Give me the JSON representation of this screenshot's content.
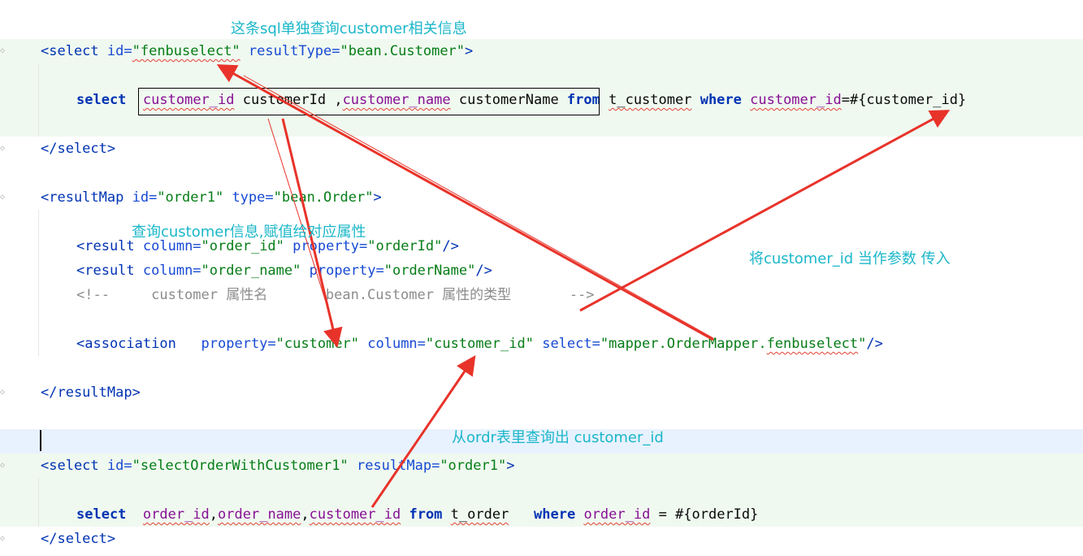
{
  "code": {
    "l1": {
      "open": "<select ",
      "id_attr": "id=",
      "id_val": "\"fenbuselect\"",
      "rt_attr": " resultType=",
      "rt_val": "\"bean.Customer\"",
      "close": ">"
    },
    "l2": {
      "kw": "select ",
      "c1": "customer_id",
      "a1": " customerId ,",
      "c2": "customer_name",
      "a2": " customerName ",
      "kw2": "from ",
      "tbl": "t_customer",
      "kw3": " where ",
      "c3": "customer_id",
      "rest": "=#{customer_id}"
    },
    "l3": {
      "text": "</select>"
    },
    "l4": {
      "open": "<resultMap ",
      "id_attr": "id=",
      "id_val": "\"order1\"",
      "t_attr": " type=",
      "t_val": "\"bean.Order\"",
      "close": ">"
    },
    "l5": {
      "open": "<result ",
      "c_attr": "column=",
      "c_val": "\"order_id\"",
      "p_attr": " property=",
      "p_val": "\"orderId\"",
      "close": "/>"
    },
    "l6": {
      "open": "<result ",
      "c_attr": "column=",
      "c_val": "\"order_name\"",
      "p_attr": " property=",
      "p_val": "\"orderName\"",
      "close": "/>"
    },
    "l7": {
      "start": "<!--     customer ",
      "cjk1": "属性名",
      "mid": "       bean.Customer ",
      "cjk2": "属性的类型",
      "end": "       -->"
    },
    "l8": {
      "open": "<association ",
      "p_attr": "  property=",
      "p_val": "\"customer\"",
      "c_attr": " column=",
      "c_val": "\"customer_id\"",
      "s_attr": " select=",
      "s_val1": "\"mapper.OrderMapper.",
      "s_val2": "fenbuselect",
      "s_val3": "\"",
      "close": "/>"
    },
    "l9": {
      "text": "</resultMap>"
    },
    "l10": {
      "open": "<select ",
      "id_attr": "id=",
      "id_val": "\"selectOrderWithCustomer1\"",
      "rm_attr": " resultMap=",
      "rm_val": "\"order1\"",
      "close": ">"
    },
    "l11": {
      "kw": "select  ",
      "c1": "order_id",
      "s1": ",",
      "c2": "order_name",
      "s2": ",",
      "c3": "customer_id",
      "kw2": " from ",
      "tbl": "t_order",
      "kw3": "   where ",
      "c4": "order_id",
      "rest": " = #{orderId}"
    },
    "l12": {
      "text": "</select>"
    }
  },
  "annotations": {
    "top": "这条sql单独查询customer相关信息",
    "middle": "查询customer信息,赋值给对应属性",
    "right": "将customer_id 当作参数 传入",
    "bottom": "从ordr表里查询出 customer_id"
  },
  "colors": {
    "annotation_text": "#1bb7c9",
    "arrow": "#e8332a",
    "tag": "#0033b3",
    "value": "#067d17",
    "column": "#871094",
    "comment": "#8c8c8c"
  }
}
